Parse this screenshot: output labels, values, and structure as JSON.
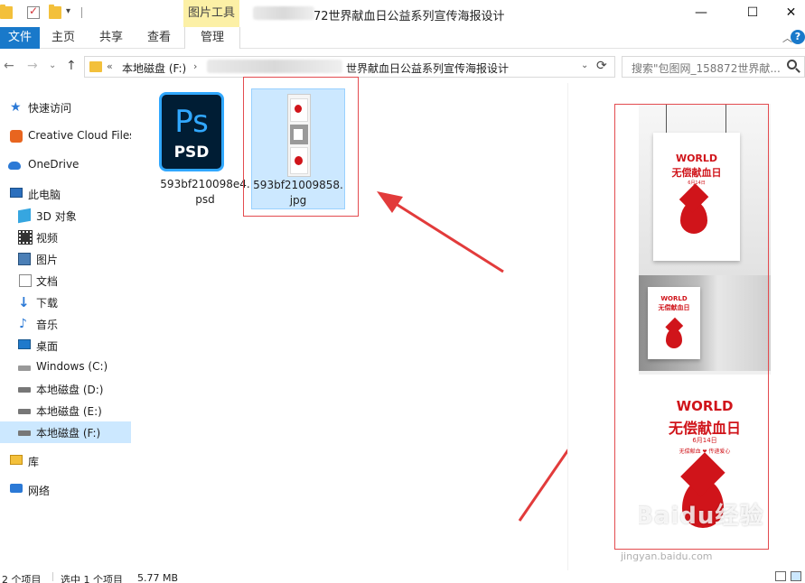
{
  "window": {
    "context_tab": "图片工具",
    "title": "72世界献血日公益系列宣传海报设计",
    "controls": {
      "minimize": "—",
      "maximize": "☐",
      "close": "✕"
    }
  },
  "ribbon": {
    "file": "文件",
    "tabs": [
      "主页",
      "共享",
      "查看"
    ],
    "manage": "管理",
    "collapse": "︿",
    "help": "?"
  },
  "navigation": {
    "back": "←",
    "forward": "→",
    "dropdown": "⌄",
    "up": "↑",
    "address_prefix": "«",
    "address_drive": "本地磁盘 (F:)",
    "address_sep": "›",
    "address_folder": "世界献血日公益系列宣传海报设计",
    "address_dropdown": "⌄",
    "refresh": "⟳",
    "search_placeholder": "搜索\"包图网_158872世界献...",
    "search_icon": "search-icon"
  },
  "sidebar": {
    "items": [
      {
        "label": "快速访问",
        "icon": "star-icon"
      },
      {
        "label": "Creative Cloud Files",
        "icon": "creative-cloud-icon"
      },
      {
        "label": "OneDrive",
        "icon": "cloud-icon"
      },
      {
        "label": "此电脑",
        "icon": "computer-icon"
      },
      {
        "label": "3D 对象",
        "icon": "3d-objects-icon"
      },
      {
        "label": "视频",
        "icon": "video-icon"
      },
      {
        "label": "图片",
        "icon": "pictures-icon"
      },
      {
        "label": "文档",
        "icon": "documents-icon"
      },
      {
        "label": "下载",
        "icon": "download-icon"
      },
      {
        "label": "音乐",
        "icon": "music-icon"
      },
      {
        "label": "桌面",
        "icon": "desktop-icon"
      },
      {
        "label": "Windows (C:)",
        "icon": "windows-drive-icon"
      },
      {
        "label": "本地磁盘 (D:)",
        "icon": "drive-icon"
      },
      {
        "label": "本地磁盘 (E:)",
        "icon": "drive-icon"
      },
      {
        "label": "本地磁盘 (F:)",
        "icon": "drive-icon"
      },
      {
        "label": "库",
        "icon": "library-icon"
      },
      {
        "label": "网络",
        "icon": "network-icon"
      }
    ]
  },
  "files": [
    {
      "name_line1": "593bf210098e4.",
      "name_line2": "psd",
      "icon_text": "Ps",
      "icon_sub": "PSD",
      "selected": false
    },
    {
      "name_line1": "593bf21009858.",
      "name_line2": "jpg",
      "selected": true
    }
  ],
  "preview": {
    "poster_world": "WORLD",
    "poster_cn": "无偿献血日",
    "poster_date": "6月14日",
    "poster_slogan": "无偿献血 ❤ 传递爱心",
    "watermark": "Baidu经验",
    "watermark_sub": "jingyan.baidu.com"
  },
  "status": {
    "count": "2 个项目",
    "selected": "选中 1 个项目",
    "size": "5.77 MB"
  },
  "colors": {
    "accent": "#1979ca",
    "selection": "#cce8ff",
    "highlight_box": "#e34b4f",
    "arrow": "#e23b3b",
    "poster_red": "#d0141a"
  }
}
